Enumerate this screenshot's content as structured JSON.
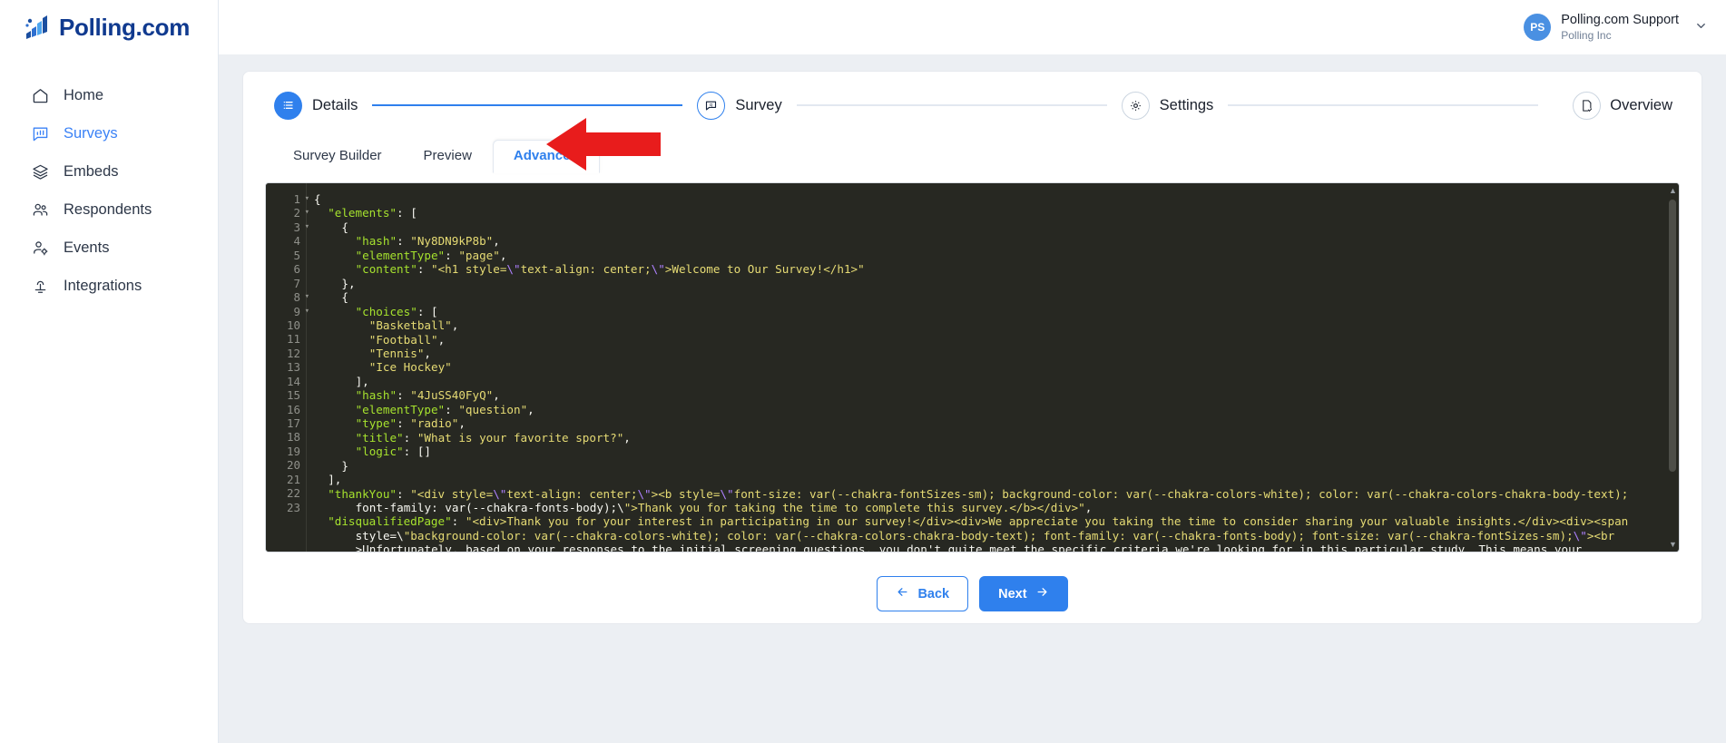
{
  "brand": {
    "name": "Polling.com",
    "logo_icon": "bar-chart-logo-icon"
  },
  "sidebar": {
    "items": [
      {
        "label": "Home",
        "icon": "home-icon",
        "active": false
      },
      {
        "label": "Surveys",
        "icon": "survey-chart-icon",
        "active": true
      },
      {
        "label": "Embeds",
        "icon": "layers-icon",
        "active": false
      },
      {
        "label": "Respondents",
        "icon": "users-icon",
        "active": false
      },
      {
        "label": "Events",
        "icon": "user-gear-icon",
        "active": false
      },
      {
        "label": "Integrations",
        "icon": "integration-plug-icon",
        "active": false
      }
    ]
  },
  "topbar": {
    "avatar_initials": "PS",
    "account_name": "Polling.com Support",
    "account_org": "Polling Inc",
    "caret_icon": "chevron-down-icon"
  },
  "stepper": {
    "steps": [
      {
        "label": "Details",
        "icon": "list-icon",
        "state": "filled"
      },
      {
        "label": "Survey",
        "icon": "survey-question-icon",
        "state": "hollow-active"
      },
      {
        "label": "Settings",
        "icon": "gear-icon",
        "state": "hollow"
      }
    ],
    "overview": {
      "label": "Overview",
      "icon": "document-check-icon"
    }
  },
  "tabs": [
    {
      "label": "Survey Builder",
      "active": false
    },
    {
      "label": "Preview",
      "active": false
    },
    {
      "label": "Advanced",
      "active": true
    }
  ],
  "editor": {
    "language": "json",
    "line_numbers": [
      "1",
      "2",
      "3",
      "4",
      "5",
      "6",
      "7",
      "8",
      "9",
      "10",
      "11",
      "12",
      "13",
      "14",
      "15",
      "16",
      "17",
      "18",
      "19",
      "20",
      "21",
      "22",
      "23"
    ],
    "foldable_lines": [
      "1",
      "2",
      "3",
      "8",
      "9"
    ],
    "lines": [
      "{",
      "  \"elements\": [",
      "    {",
      "      \"hash\": \"Ny8DN9kP8b\",",
      "      \"elementType\": \"page\",",
      "      \"content\": \"<h1 style=\\\"text-align: center;\\\">Welcome to Our Survey!</h1>\"",
      "    },",
      "    {",
      "      \"choices\": [",
      "        \"Basketball\",",
      "        \"Football\",",
      "        \"Tennis\",",
      "        \"Ice Hockey\"",
      "      ],",
      "      \"hash\": \"4JuSS40FyQ\",",
      "      \"elementType\": \"question\",",
      "      \"type\": \"radio\",",
      "      \"title\": \"What is your favorite sport?\",",
      "      \"logic\": []",
      "    }",
      "  ],",
      "  \"thankYou\": \"<div style=\\\"text-align: center;\\\"><b style=\\\"font-size: var(--chakra-fontSizes-sm); background-color: var(--chakra-colors-white); color: var(--chakra-colors-chakra-body-text);",
      "      font-family: var(--chakra-fonts-body);\\\">Thank you for taking the time to complete this survey.</b></div>\",",
      "  \"disqualifiedPage\": \"<div>Thank you for your interest in participating in our survey!</div><div>We appreciate you taking the time to consider sharing your valuable insights.</div><div><span",
      "      style=\\\"background-color: var(--chakra-colors-white); color: var(--chakra-colors-chakra-body-text); font-family: var(--chakra-fonts-body); font-size: var(--chakra-fontSizes-sm);\\\"><br",
      "      >Unfortunately, based on your responses to the initial screening questions, you don't quite meet the specific criteria we're looking for in this particular study. This means your"
    ]
  },
  "footer": {
    "back_label": "Back",
    "back_icon": "arrow-left-icon",
    "next_label": "Next",
    "next_icon": "arrow-right-icon"
  },
  "annotation": {
    "arrow_icon": "red-pointer-arrow-icon",
    "color": "#e81c1c"
  },
  "colors": {
    "brand_blue": "#103a8f",
    "accent_blue": "#2f80ed",
    "active_nav": "#3b82f6",
    "page_bg": "#eceff3",
    "editor_bg": "#272822",
    "code_key": "#a6e22e",
    "code_string": "#e6db74",
    "code_escape": "#ae81ff",
    "annotation_red": "#e81c1c"
  }
}
